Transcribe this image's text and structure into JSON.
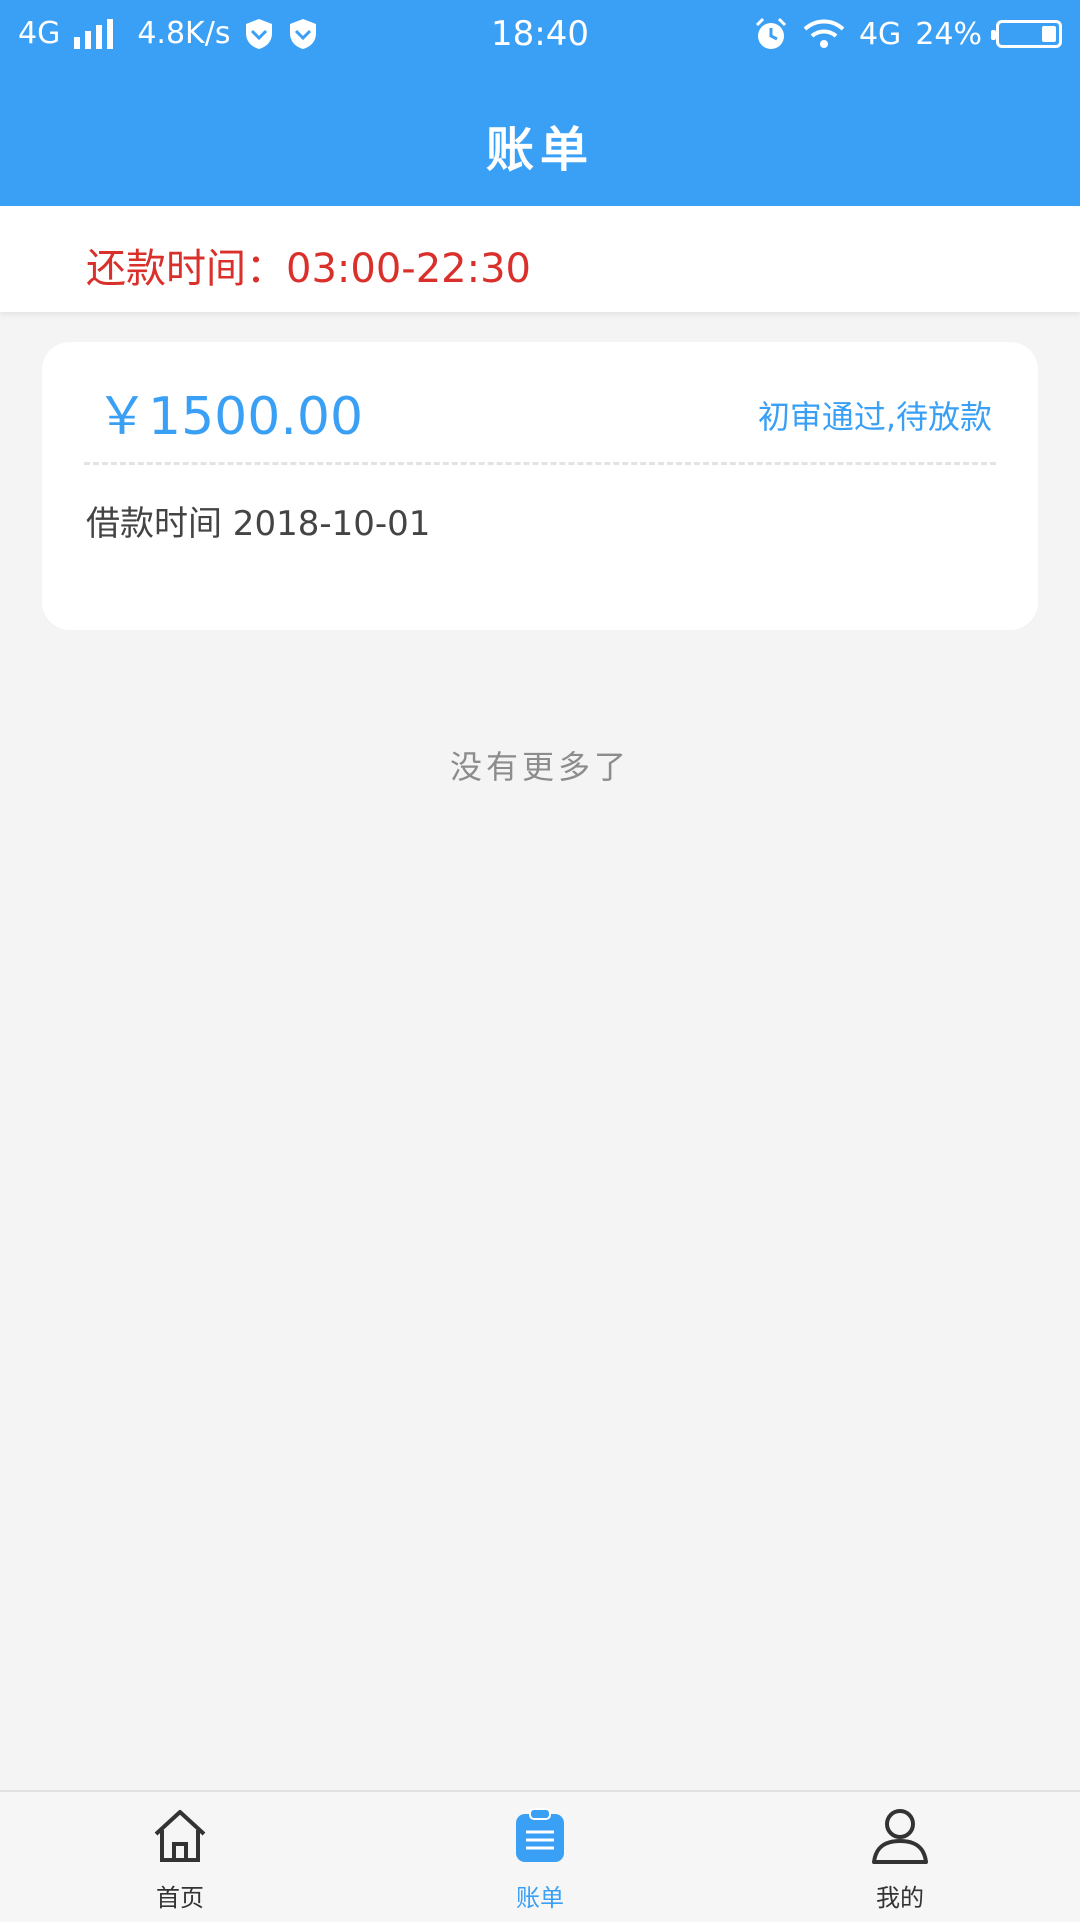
{
  "status_bar": {
    "network_left": "4G",
    "speed": "4.8K/s",
    "time": "18:40",
    "network_right": "4G",
    "battery": "24%"
  },
  "header": {
    "title": "账单"
  },
  "notice": {
    "repay_time": "还款时间：03:00-22:30"
  },
  "bill": {
    "amount": "￥1500.00",
    "status": "初审通过,待放款",
    "loan_date": "借款时间 2018-10-01"
  },
  "list_end": "没有更多了",
  "tabs": [
    {
      "label": "首页",
      "icon": "home-icon"
    },
    {
      "label": "账单",
      "icon": "bill-icon"
    },
    {
      "label": "我的",
      "icon": "user-icon"
    }
  ],
  "colors": {
    "primary": "#3aa0f5",
    "warning": "#d9302c"
  }
}
